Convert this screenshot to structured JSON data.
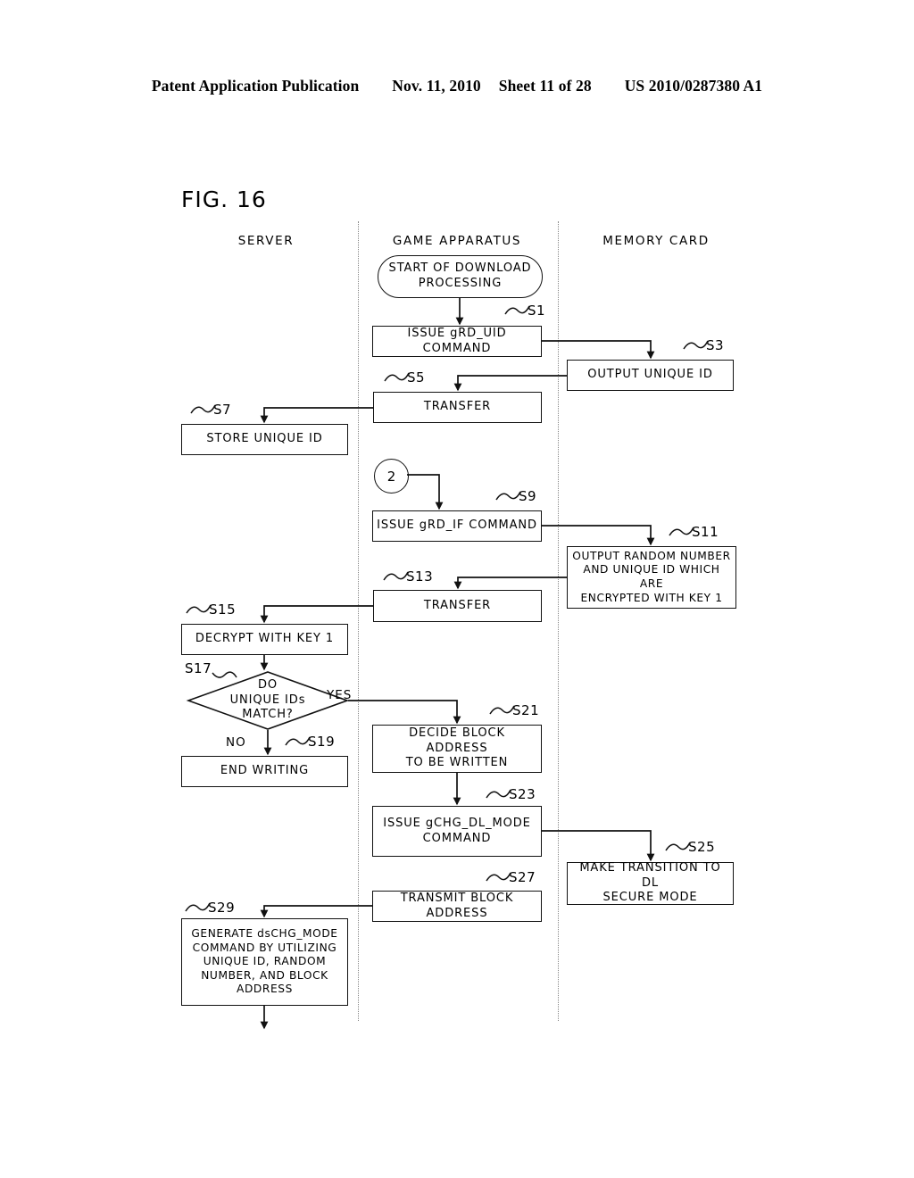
{
  "header": {
    "publication": "Patent Application Publication",
    "date": "Nov. 11, 2010",
    "sheet": "Sheet 11 of 28",
    "patent_number": "US 2010/0287380 A1"
  },
  "figure": {
    "title": "FIG. 16",
    "lanes": [
      {
        "name": "server",
        "label": "SERVER"
      },
      {
        "name": "game-apparatus",
        "label": "GAME APPARATUS"
      },
      {
        "name": "memory-card",
        "label": "MEMORY CARD"
      }
    ],
    "nodes": {
      "start": {
        "label": "START OF DOWNLOAD\nPROCESSING",
        "shape": "terminator",
        "lane": "game-apparatus"
      },
      "s1": {
        "step": "S1",
        "label": "ISSUE gRD_UID COMMAND",
        "lane": "game-apparatus"
      },
      "s3": {
        "step": "S3",
        "label": "OUTPUT UNIQUE ID",
        "lane": "memory-card"
      },
      "s5": {
        "step": "S5",
        "label": "TRANSFER",
        "lane": "game-apparatus"
      },
      "s7": {
        "step": "S7",
        "label": "STORE UNIQUE ID",
        "lane": "server"
      },
      "connector2": {
        "label": "2",
        "shape": "connector",
        "lane": "game-apparatus"
      },
      "s9": {
        "step": "S9",
        "label": "ISSUE gRD_IF COMMAND",
        "lane": "game-apparatus"
      },
      "s11": {
        "step": "S11",
        "label": "OUTPUT RANDOM NUMBER\nAND UNIQUE ID WHICH ARE\nENCRYPTED WITH KEY 1",
        "lane": "memory-card"
      },
      "s13": {
        "step": "S13",
        "label": "TRANSFER",
        "lane": "game-apparatus"
      },
      "s15": {
        "step": "S15",
        "label": "DECRYPT WITH KEY 1",
        "lane": "server"
      },
      "s17": {
        "step": "S17",
        "label": "DO\nUNIQUE IDs\nMATCH?",
        "shape": "decision",
        "lane": "server",
        "branches": {
          "yes": "YES",
          "no": "NO"
        }
      },
      "s19": {
        "step": "S19",
        "label": "END WRITING",
        "lane": "server"
      },
      "s21": {
        "step": "S21",
        "label": "DECIDE BLOCK ADDRESS\nTO BE WRITTEN",
        "lane": "game-apparatus"
      },
      "s23": {
        "step": "S23",
        "label": "ISSUE gCHG_DL_MODE\nCOMMAND",
        "lane": "game-apparatus"
      },
      "s25": {
        "step": "S25",
        "label": "MAKE TRANSITION TO DL\nSECURE MODE",
        "lane": "memory-card"
      },
      "s27": {
        "step": "S27",
        "label": "TRANSMIT BLOCK ADDRESS",
        "lane": "game-apparatus"
      },
      "s29": {
        "step": "S29",
        "label": "GENERATE dsCHG_MODE\nCOMMAND BY UTILIZING\nUNIQUE ID, RANDOM\nNUMBER, AND BLOCK\nADDRESS",
        "lane": "server"
      }
    }
  },
  "colors": {
    "ink": "#111111",
    "divider": "#888888",
    "paper": "#ffffff"
  }
}
